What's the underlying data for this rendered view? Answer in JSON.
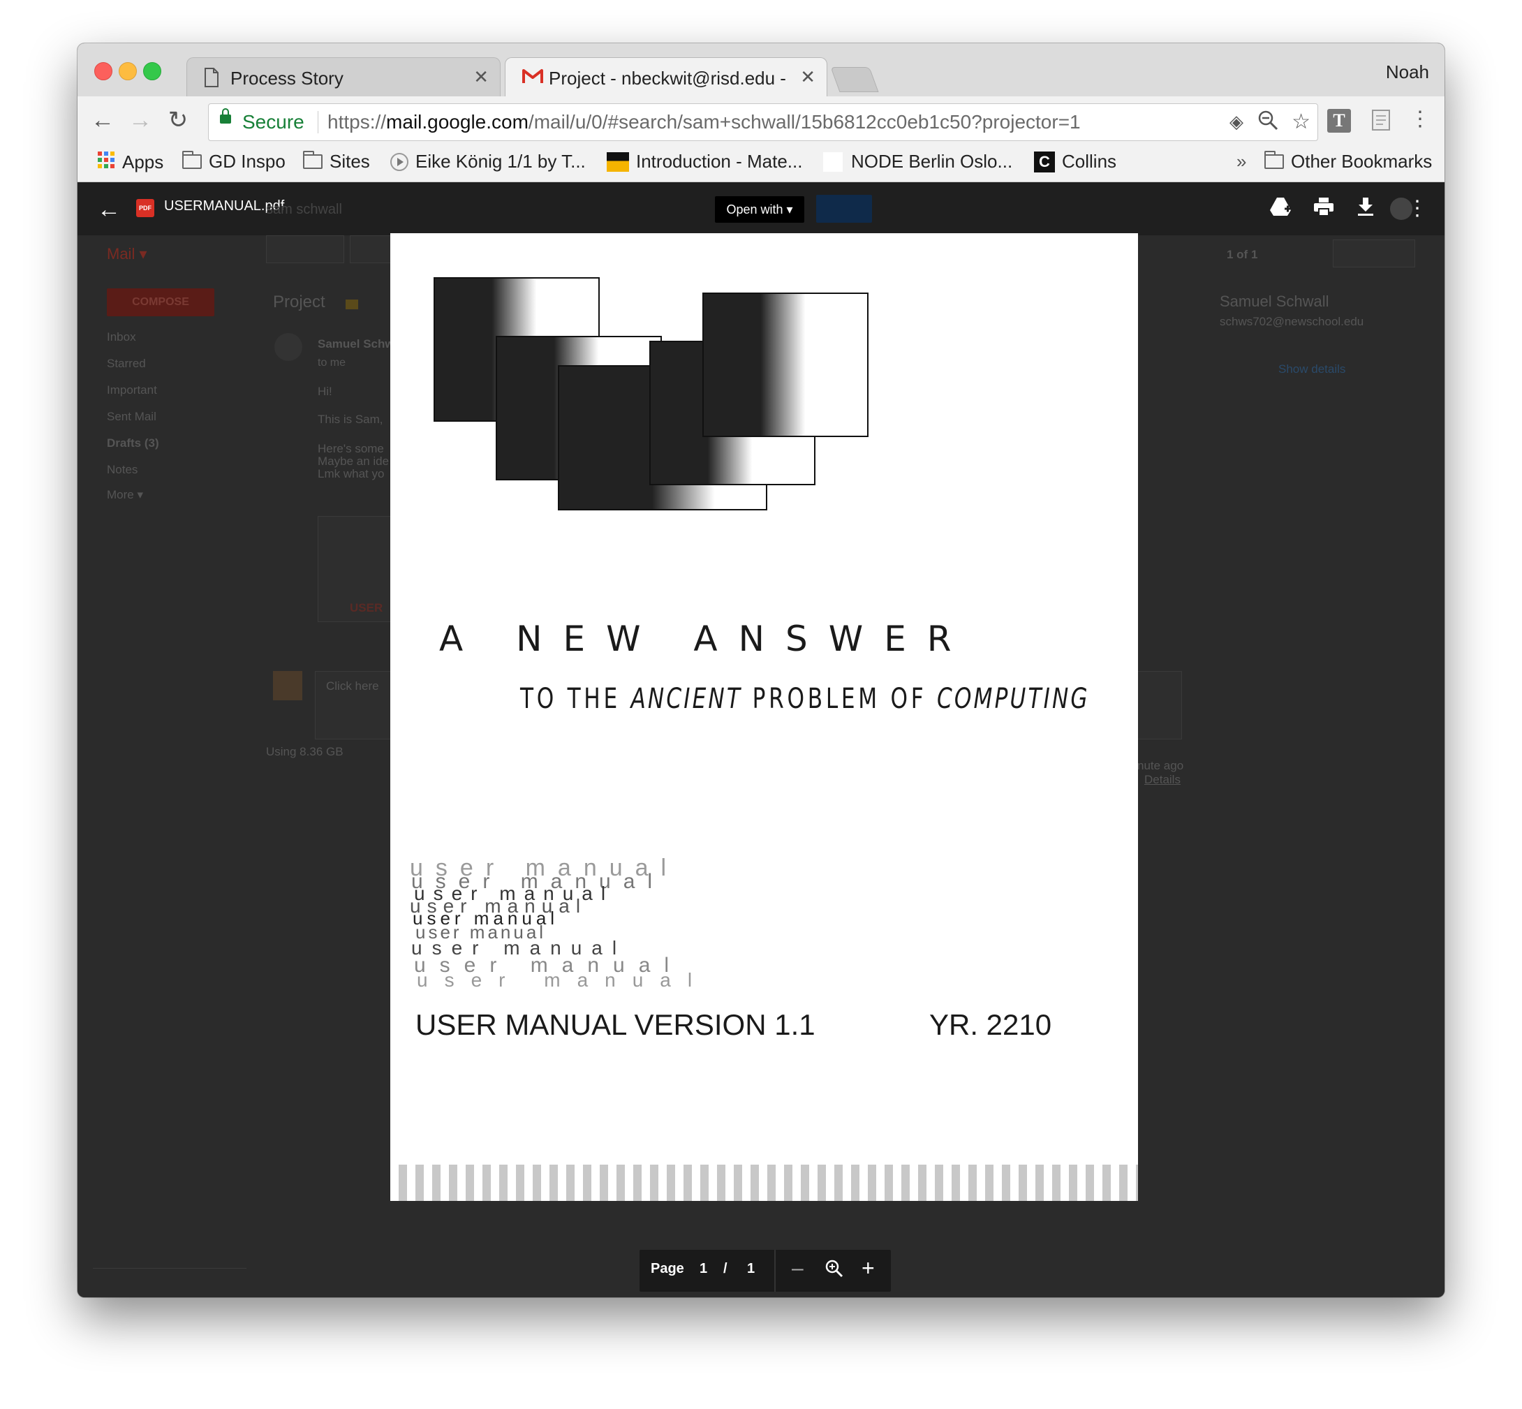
{
  "browser": {
    "profile_name": "Noah",
    "tabs": [
      {
        "title": "Process Story",
        "active": false,
        "icon": "document-icon"
      },
      {
        "title": "Project - nbeckwit@risd.edu -",
        "active": true,
        "icon": "gmail-icon"
      }
    ],
    "security_label": "Secure",
    "url_scheme": "https://",
    "url_host": "mail.google.com",
    "url_path": "/mail/u/0/#search/sam+schwall/15b6812cc0eb1c50?projector=1"
  },
  "bookmarks": {
    "items": [
      {
        "label": "Apps",
        "icon": "apps-grid-icon"
      },
      {
        "label": "GD Inspo",
        "icon": "folder-icon"
      },
      {
        "label": "Sites",
        "icon": "folder-icon"
      },
      {
        "label": "Eike König 1/1 by T...",
        "icon": "play-icon"
      },
      {
        "label": "Introduction - Mate...",
        "icon": "flag-icon"
      },
      {
        "label": "NODE Berlin Oslo...",
        "icon": "blank-icon"
      },
      {
        "label": "Collins",
        "icon": "collins-icon"
      }
    ],
    "overflow": "»",
    "other": "Other Bookmarks"
  },
  "gmail": {
    "search_query": "sam schwall",
    "mail_label": "Mail ▾",
    "compose": "COMPOSE",
    "nav": [
      "Inbox",
      "Starred",
      "Important",
      "Sent Mail",
      "Drafts (3)",
      "Notes",
      "More ▾"
    ],
    "subject": "Project",
    "sender": "Samuel Schwall",
    "to_me": "to me",
    "body_lines": [
      "Hi!",
      "This is Sam,",
      "Here's some",
      "Maybe an ide",
      "Lmk what yo"
    ],
    "attachment_label": "USER",
    "reply_placeholder": "Click here",
    "storage": "Using 8.36 GB",
    "last_activity": "nute ago",
    "details": "Details",
    "pager": "1 of 1",
    "contact_name": "Samuel Schwall",
    "contact_email": "schws702@newschool.edu",
    "show_details": "Show details"
  },
  "viewer": {
    "filename": "USERMANUAL.pdf",
    "open_with": "Open with",
    "page_label": "Page",
    "current_page": "1",
    "page_sep": "/",
    "total_pages": "1"
  },
  "document": {
    "headline": "A NEW ANSWER",
    "subtitle_1": "TO THE ",
    "subtitle_2": "ANCIENT",
    "subtitle_3": " PROBLEM OF ",
    "subtitle_4": "COMPUTING",
    "scramble_top": "user manual",
    "version": "USER MANUAL VERSION 1.1",
    "year": "YR. 2210"
  }
}
